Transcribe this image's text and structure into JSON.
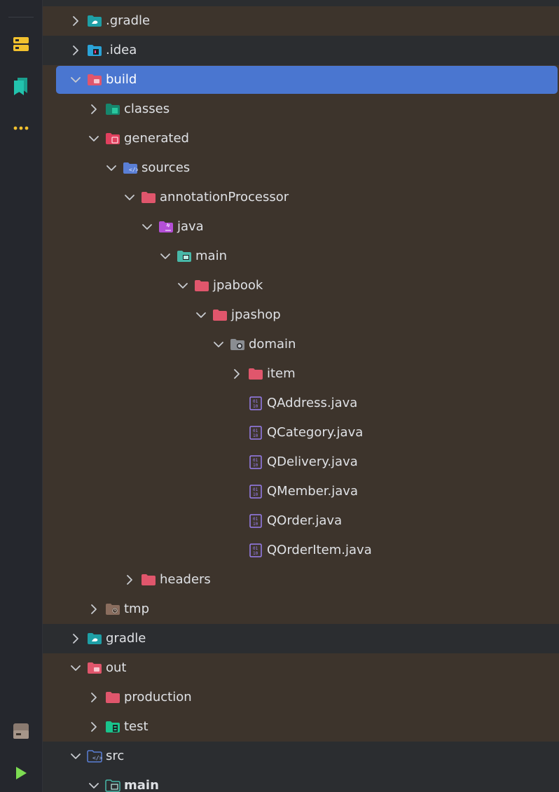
{
  "sidebar": {
    "icons": [
      "structure-icon",
      "bookmarks-icon",
      "more-icon",
      "terminal-icon",
      "run-icon"
    ]
  },
  "colors": {
    "band_brown": "#3d342c",
    "band_dark": "#2b2d30",
    "selection": "#4a76d0",
    "folder_red": "#e0566c",
    "folder_teal": "#1e9fa6",
    "folder_blue": "#5a7fd6",
    "folder_purple": "#b44fd6",
    "java_file": "#9a7ff0"
  },
  "tree": {
    "items": [
      {
        "label": ".gradle"
      },
      {
        "label": ".idea"
      },
      {
        "label": "build"
      },
      {
        "label": "classes"
      },
      {
        "label": "generated"
      },
      {
        "label": "sources"
      },
      {
        "label": "annotationProcessor"
      },
      {
        "label": "java"
      },
      {
        "label": "main"
      },
      {
        "label": "jpabook"
      },
      {
        "label": "jpashop"
      },
      {
        "label": "domain"
      },
      {
        "label": "item"
      },
      {
        "label": "QAddress.java"
      },
      {
        "label": "QCategory.java"
      },
      {
        "label": "QDelivery.java"
      },
      {
        "label": "QMember.java"
      },
      {
        "label": "QOrder.java"
      },
      {
        "label": "QOrderItem.java"
      },
      {
        "label": "headers"
      },
      {
        "label": "tmp"
      },
      {
        "label": "gradle"
      },
      {
        "label": "out"
      },
      {
        "label": "production"
      },
      {
        "label": "test"
      },
      {
        "label": "src"
      },
      {
        "label": "main"
      }
    ]
  }
}
